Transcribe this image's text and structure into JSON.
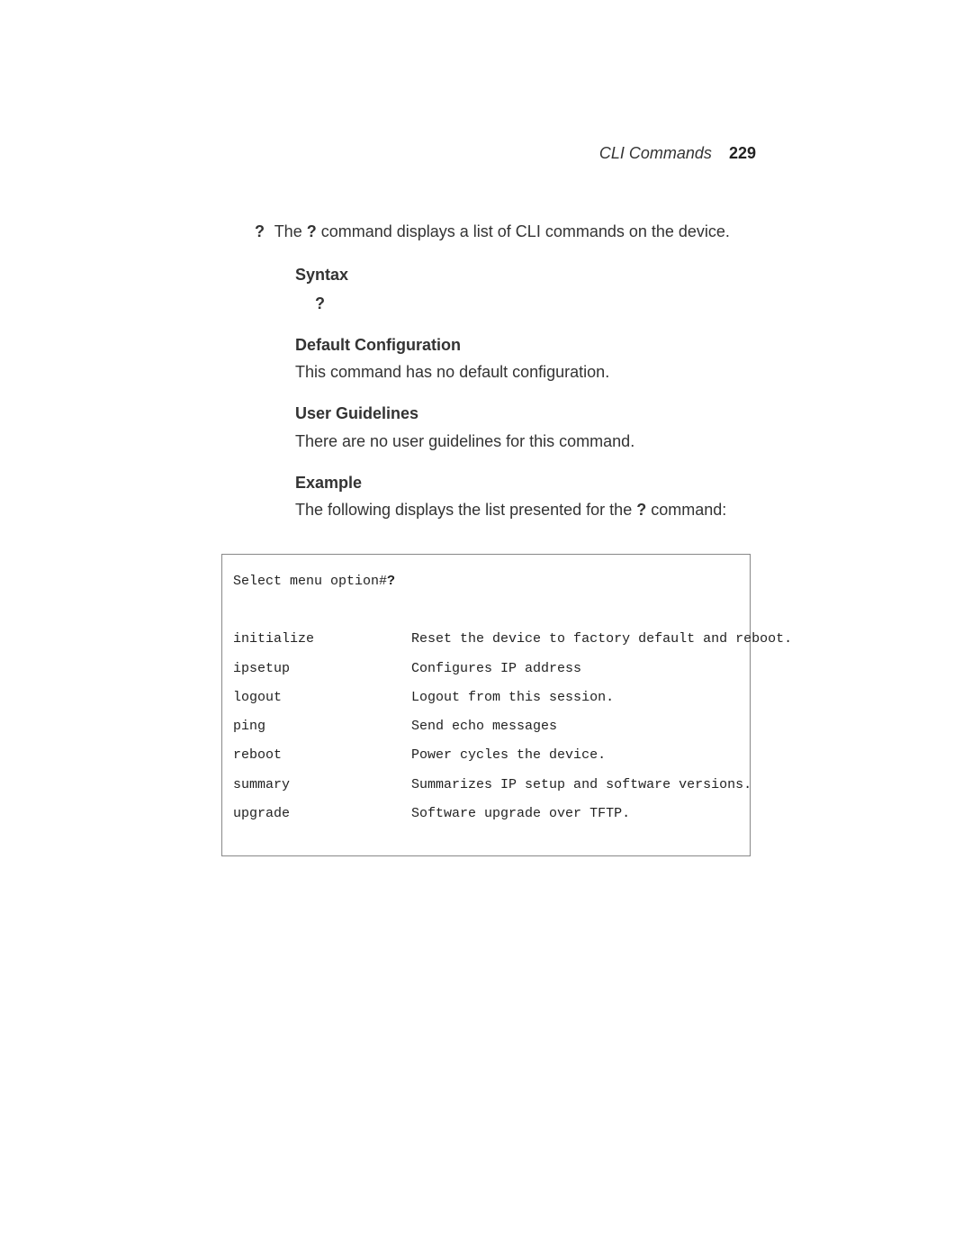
{
  "header": {
    "title": "CLI Commands",
    "page": "229"
  },
  "intro": {
    "marker": "?",
    "before": "The ",
    "cmd": "?",
    "after": " command displays a list of CLI commands on the device."
  },
  "syntax": {
    "heading": "Syntax",
    "value": "?"
  },
  "defaultcfg": {
    "heading": "Default Configuration",
    "text": "This command has no default configuration."
  },
  "userguidelines": {
    "heading": "User Guidelines",
    "text": "There are no user guidelines for this command."
  },
  "example": {
    "heading": "Example",
    "before": "The following displays the list presented for the ",
    "cmd": "?",
    "after": " command:"
  },
  "code": {
    "prompt_prefix": "Select menu option#",
    "prompt_cmd": "?",
    "rows": [
      {
        "cmd": "initialize",
        "desc": "Reset the device to factory default and reboot."
      },
      {
        "cmd": "ipsetup",
        "desc": "Configures IP address"
      },
      {
        "cmd": "logout",
        "desc": "Logout from this session."
      },
      {
        "cmd": "ping",
        "desc": "Send echo messages"
      },
      {
        "cmd": "reboot",
        "desc": "Power cycles the device."
      },
      {
        "cmd": "summary",
        "desc": "Summarizes IP setup and software versions."
      },
      {
        "cmd": "upgrade",
        "desc": "Software upgrade over TFTP."
      }
    ]
  }
}
